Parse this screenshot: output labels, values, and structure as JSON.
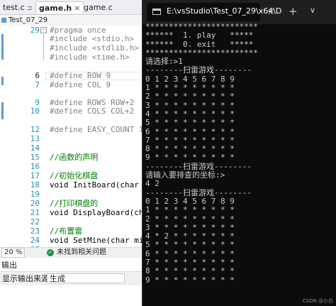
{
  "editor": {
    "tabs": [
      {
        "label": "test.c",
        "extra": "⊐",
        "active": false
      },
      {
        "label": "game.h",
        "extra": "×",
        "active": true
      },
      {
        "label": "game.c",
        "extra": "",
        "active": false
      }
    ],
    "project": "Test_07_29",
    "lines": [
      {
        "n": "29",
        "text": "#pragma once"
      },
      {
        "n": "",
        "text": "#include <stdio.h>"
      },
      {
        "n": "",
        "text": "#include <stdlib.h>"
      },
      {
        "n": "",
        "text": "#include <time.h>"
      },
      {
        "n": "",
        "text": ""
      },
      {
        "n": "6",
        "text": "#define ROW 9"
      },
      {
        "n": "7",
        "text": "#define COL 9"
      },
      {
        "n": "",
        "text": ""
      },
      {
        "n": "9",
        "text": "#define ROWS ROW+2"
      },
      {
        "n": "10",
        "text": "#define COLS COL+2"
      },
      {
        "n": "",
        "text": ""
      },
      {
        "n": "12",
        "text": "#define EASY_COUNT 10"
      },
      {
        "n": "13",
        "text": ""
      },
      {
        "n": "14",
        "text": ""
      },
      {
        "n": "15",
        "text": "//函数的声明"
      },
      {
        "n": "16",
        "text": ""
      },
      {
        "n": "17",
        "text": "//初始化棋盘"
      },
      {
        "n": "18",
        "text": "void InitBoard(char board"
      },
      {
        "n": "19",
        "text": ""
      },
      {
        "n": "20",
        "text": "//打印棋盘的"
      },
      {
        "n": "21",
        "text": "void DisplayBoard(char bo"
      },
      {
        "n": "22",
        "text": ""
      },
      {
        "n": "23",
        "text": "//布置雷"
      },
      {
        "n": "24",
        "text": "void SetMine(char mine[RO"
      },
      {
        "n": "25",
        "text": ""
      }
    ],
    "status": {
      "zoom": "20 %",
      "message": "未找到相关问题"
    },
    "output": {
      "title": "输出",
      "source_label": "显示输出来源(S):",
      "source_value": "生成"
    }
  },
  "console": {
    "title": "E:\\vsStudio\\Test_07_29\\x64\\D",
    "close_glyph": "×",
    "new_tab_glyph": "+",
    "dropdown_glyph": "∨",
    "lines": [
      "************************",
      "******  1. play   *****",
      "******  0. exit   *****",
      "************************",
      "请选择:>1",
      "--------扫雷游戏--------",
      "0 1 2 3 4 5 6 7 8 9",
      "1 * * * * * * * * *",
      "2 * * * * * * * * *",
      "3 * * * * * * * * *",
      "4 * * * * * * * * *",
      "5 * * * * * * * * *",
      "6 * * * * * * * * *",
      "7 * * * * * * * * *",
      "8 * * * * * * * * *",
      "9 * * * * * * * * *",
      "--------扫雷游戏--------",
      "请输入要排查的坐标:>",
      "4 2",
      "--------扫雷游戏--------",
      "0 1 2 3 4 5 6 7 8 9",
      "1 * * * * * * * * *",
      "2 * * * * * * * * *",
      "3 * * * * * * * * *",
      "4 * 2 * * * * * * *",
      "5 * * * * * * * * *",
      "6 * * * * * * * * *",
      "7 * * * * * * * * *",
      "8 * * * * * * * * *",
      "9 * * * * * * * * *"
    ],
    "watermark": "CSDN @小白"
  }
}
